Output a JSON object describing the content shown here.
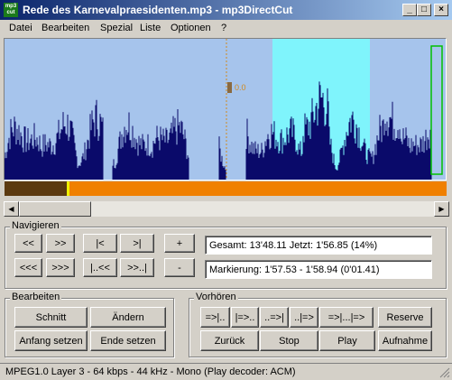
{
  "window": {
    "title": "Rede des Karnevalpraesidenten.mp3 - mp3DirectCut",
    "icon_text": "mp3 cut",
    "controls": [
      "_",
      "□",
      "×"
    ]
  },
  "menu": [
    {
      "label": "Datei"
    },
    {
      "label": "Bearbeiten"
    },
    {
      "label": "Spezial"
    },
    {
      "label": "Liste"
    },
    {
      "label": "Optionen"
    },
    {
      "label": "?"
    }
  ],
  "waveform": {
    "level_label": "0.0",
    "colors": {
      "background": "#a6c4ec",
      "wave": "#0a0a6a",
      "selection": "#7ff4fc",
      "cursor": "#d08a20",
      "marker": "#00c000"
    },
    "playback_fraction": 0.14
  },
  "progress": {
    "played_color": "#5c3a10",
    "remaining_color": "#f08000",
    "position_color": "#f0f000"
  },
  "navigieren": {
    "title": "Navigieren",
    "buttons_row1": [
      "<<",
      ">>",
      "|<",
      ">|",
      "+"
    ],
    "buttons_row2": [
      "<<<",
      ">>>",
      "|..<<",
      ">>..|",
      "-"
    ],
    "info_total": "Gesamt: 13'48.11   Jetzt: 1'56.85   (14%)",
    "info_marker": "Markierung: 1'57.53 - 1'58.94 (0'01.41)"
  },
  "bearbeiten": {
    "title": "Bearbeiten",
    "schnitt": "Schnitt",
    "aendern": "Ändern",
    "anfang": "Anfang setzen",
    "ende": "Ende setzen"
  },
  "vorhoeren": {
    "title": "Vorhören",
    "row1": [
      "=>|..",
      "|=>..",
      "..=>|",
      "..|=>",
      "=>|...|=>"
    ],
    "reserve": "Reserve",
    "zurueck": "Zurück",
    "stop": "Stop",
    "play": "Play",
    "aufnahme": "Aufnahme"
  },
  "status": "MPEG1.0 Layer 3 - 64 kbps - 44 kHz - Mono   (Play decoder: ACM)"
}
